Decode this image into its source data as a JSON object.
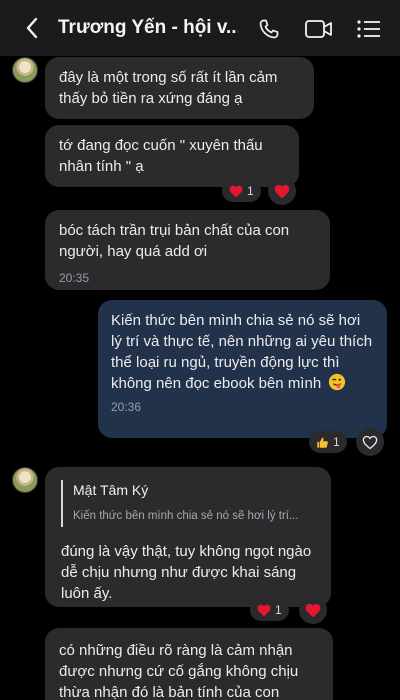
{
  "header": {
    "title": "Trương Yến - hội v..."
  },
  "messages": {
    "m1": {
      "text": "đây là một trong số rất ít lần cảm thấy bỏ tiền ra xứng đáng ạ"
    },
    "m2": {
      "text": "tớ đang đọc cuốn \" xuyên thấu nhân tính \" ạ",
      "reaction_count": "1"
    },
    "m3": {
      "text": "bóc tách trần trụi bản chất của con người, hay quá add ơi",
      "time": "20:35"
    },
    "m4": {
      "text": "Kiến thức bên mình chia sẻ nó sẽ hơi lý trí và thực tế, nên những ai yêu thích thể loại ru ngủ, truyền động lực thì không nên đọc ebook bên mình",
      "time": "20:36",
      "reaction_count": "1"
    },
    "m5": {
      "quote_name": "Mật Tâm Ký",
      "quote_text": "Kiến thức bên mình chia sẻ nó sẽ hơi lý trí...",
      "text": "đúng là vậy thật, tuy không ngọt ngào dễ chịu nhưng như được khai sáng luôn ấy.",
      "reaction_count": "1"
    },
    "m6": {
      "text": "có những điều rõ ràng là cảm nhận được nhưng cứ cố gắng không chịu thừa  nhận đó là bản tính của con"
    }
  },
  "icons": {
    "back": "chevron-left-icon",
    "call": "phone-icon",
    "video": "video-camera-icon",
    "menu": "menu-list-icon",
    "heart": "heart-icon",
    "thumb": "thumbs-up-icon",
    "emoji": "winking-tongue-emoji-icon"
  },
  "colors": {
    "incoming_bubble": "#2b2b2e",
    "outgoing_bubble": "#23324b",
    "heart": "#e5162f",
    "header_bg": "#1b1b1d"
  }
}
